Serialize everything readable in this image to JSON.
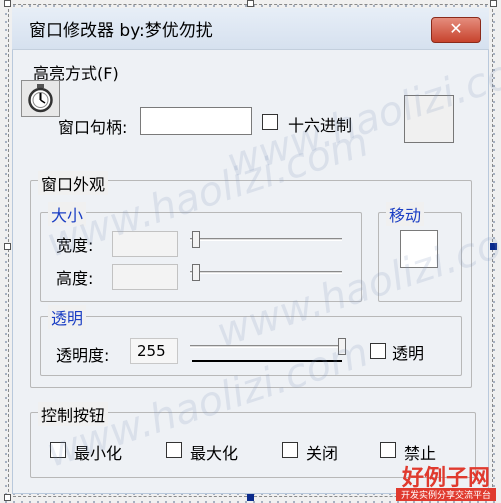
{
  "window": {
    "title": "窗口修改器 by:梦优勿扰",
    "close_label": "✕"
  },
  "menu": {
    "highlight_label": "高亮方式(F)"
  },
  "toolbar": {
    "timer_icon": "stopwatch-icon"
  },
  "handle_section": {
    "label": "窗口句柄:",
    "value": "",
    "hex_label": "十六进制",
    "hex_checked": false
  },
  "appearance": {
    "legend": "窗口外观",
    "size": {
      "legend": "大小",
      "width_label": "宽度:",
      "height_label": "高度:",
      "width_value": "",
      "height_value": "",
      "width_slider": 0.0,
      "height_slider": 0.0
    },
    "move": {
      "legend": "移动"
    },
    "transparency": {
      "legend": "透明",
      "label": "透明度:",
      "value": "255",
      "slider": 1.0,
      "checkbox_label": "透明",
      "checked": false
    }
  },
  "controls": {
    "legend": "控制按钮",
    "items": [
      {
        "label": "最小化",
        "checked": false
      },
      {
        "label": "最大化",
        "checked": false
      },
      {
        "label": "关闭",
        "checked": false
      },
      {
        "label": "禁止",
        "checked": false
      }
    ]
  },
  "watermark": {
    "text": "www.haolizi.com",
    "logo_title": "好例子网",
    "logo_sub": "开发实例分享交流平台"
  },
  "colors": {
    "accent_blue": "#1a3ec4",
    "close_red": "#c7432d",
    "logo_red": "#e03a2e"
  }
}
